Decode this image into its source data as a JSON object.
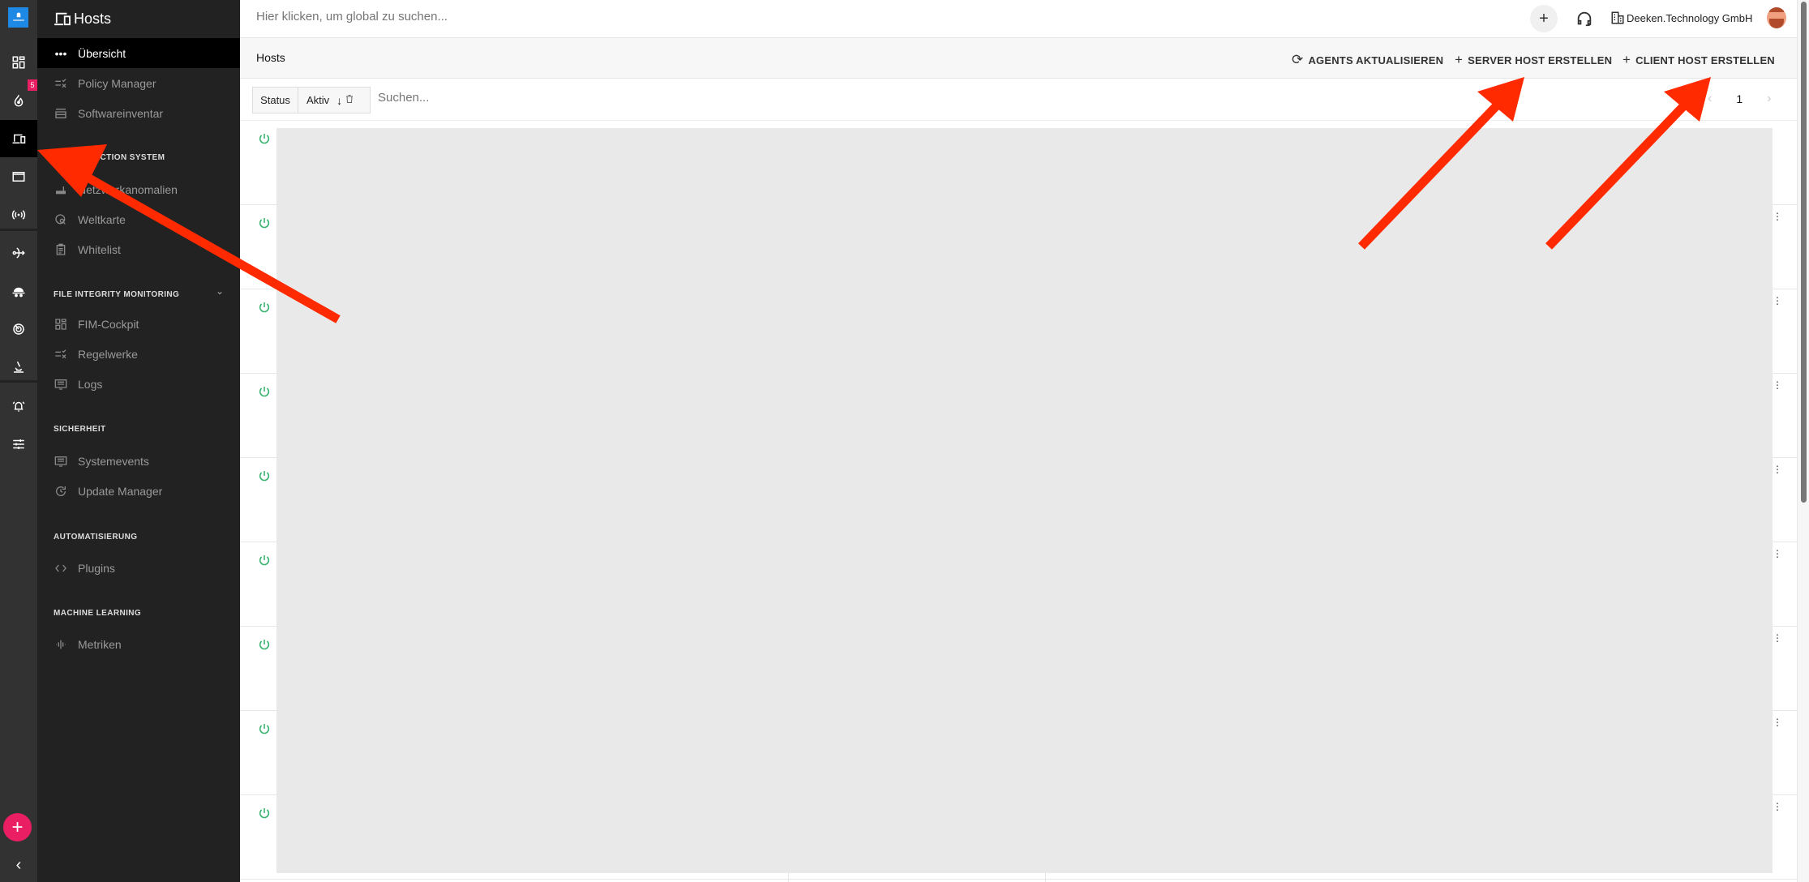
{
  "rail": {
    "logo_label": "logo",
    "incident_badge": "5",
    "fab_label": "+",
    "collapse_label": "‹"
  },
  "sidebar": {
    "title": "Hosts",
    "items_top": [
      {
        "label": "Übersicht",
        "icon": "dots-icon",
        "active": true
      },
      {
        "label": "Policy Manager",
        "icon": "checklist-icon"
      },
      {
        "label": "Softwareinventar",
        "icon": "store-icon"
      }
    ],
    "sections": [
      {
        "title": "INTRUSION DETECTION SYSTEM",
        "visible_title": "SION DETECTION SYSTEM",
        "items": [
          {
            "label": "Netzwerkanomalien",
            "icon": "router-icon"
          },
          {
            "label": "Weltkarte",
            "icon": "globe-search-icon"
          },
          {
            "label": "Whitelist",
            "icon": "clipboard-icon"
          }
        ]
      },
      {
        "title": "FILE INTEGRITY MONITORING",
        "collapsible": true,
        "items": [
          {
            "label": "FIM-Cockpit",
            "icon": "dashboard-icon"
          },
          {
            "label": "Regelwerke",
            "icon": "checklist-icon"
          },
          {
            "label": "Logs",
            "icon": "monitor-list-icon"
          }
        ]
      },
      {
        "title": "SICHERHEIT",
        "items": [
          {
            "label": "Systemevents",
            "icon": "monitor-list-icon"
          },
          {
            "label": "Update Manager",
            "icon": "update-icon"
          }
        ]
      },
      {
        "title": "AUTOMATISIERUNG",
        "items": [
          {
            "label": "Plugins",
            "icon": "code-icon"
          }
        ]
      },
      {
        "title": "MACHINE LEARNING",
        "items": [
          {
            "label": "Metriken",
            "icon": "waveform-icon"
          }
        ]
      }
    ]
  },
  "topbar": {
    "search_placeholder": "Hier klicken, um global zu suchen...",
    "add_label": "+",
    "organization": "Deeken.Technology GmbH"
  },
  "page": {
    "title": "Hosts",
    "actions": [
      {
        "label": "AGENTS AKTUALISIEREN",
        "icon": "update-icon",
        "glyph": "⟳"
      },
      {
        "label": "SERVER HOST ERSTELLEN",
        "icon": "plus-icon",
        "glyph": "+"
      },
      {
        "label": "CLIENT HOST ERSTELLEN",
        "icon": "plus-icon",
        "glyph": "+"
      }
    ]
  },
  "filter": {
    "field_label": "Status",
    "value_label": "Aktiv",
    "sort_glyph": "↓",
    "delete_glyph": "🗑",
    "search_placeholder": "Suchen...",
    "page_number": "1",
    "prev_glyph": "‹",
    "next_glyph": "›"
  },
  "rows": {
    "count": 9,
    "status": "online",
    "status_color": "#3cb371",
    "more_glyph": "⋮"
  },
  "colors": {
    "rail_bg": "#323232",
    "sidebar_bg": "#222222",
    "accent_pink": "#e91e63",
    "online_green": "#3cb371",
    "annotation_red": "#ff2a00"
  }
}
